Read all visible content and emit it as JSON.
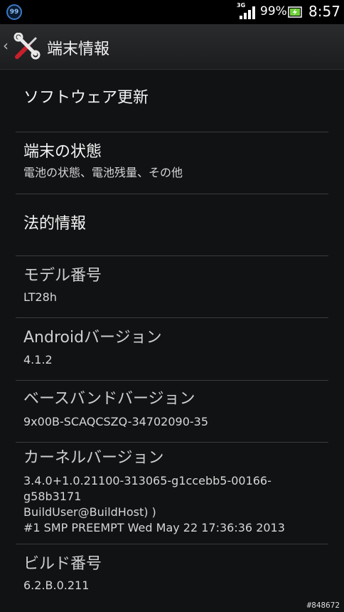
{
  "status_bar": {
    "notification_badge": "99",
    "network_type": "3G",
    "battery_percent": "99%",
    "time": "8:57",
    "icons": [
      "signal-icon",
      "battery-charging-icon"
    ]
  },
  "action_bar": {
    "back_symbol": "‹",
    "title": "端末情報",
    "icon": "tools-icon"
  },
  "items": [
    {
      "title": "ソフトウェア更新"
    },
    {
      "title": "端末の状態",
      "subtitle": "電池の状態、電池残量、その他"
    },
    {
      "title": "法的情報"
    },
    {
      "title": "モデル番号",
      "value": "LT28h"
    },
    {
      "title": "Androidバージョン",
      "value": "4.1.2"
    },
    {
      "title": "ベースバンドバージョン",
      "value": "9x00B-SCAQCSZQ-34702090-35"
    },
    {
      "title": "カーネルバージョン",
      "value_lines": [
        "3.4.0+1.0.21100-313065-g1ccebb5-00166-",
        "g58b3171",
        "BuildUser@BuildHost) )",
        "#1 SMP PREEMPT Wed May 22 17:36:36 2013"
      ]
    },
    {
      "title": "ビルド番号",
      "value": "6.2.B.0.211"
    }
  ],
  "watermark": "#848672",
  "colors": {
    "background": "#111214",
    "status_bar": "#000000",
    "badge_ring": "#3a78c8",
    "battery_fill": "#6fd13a"
  }
}
